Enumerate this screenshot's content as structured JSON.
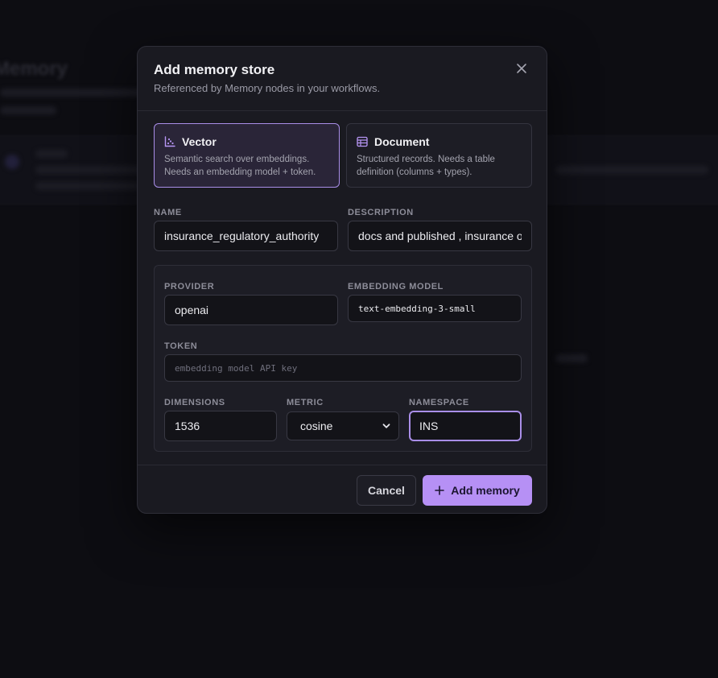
{
  "modal": {
    "title": "Add memory store",
    "subtitle": "Referenced by Memory nodes in your workflows."
  },
  "store_types": [
    {
      "title": "Vector",
      "description": "Semantic search over embeddings. Needs an embedding model + token.",
      "icon": "scatter-chart-icon",
      "selected": true
    },
    {
      "title": "Document",
      "description": "Structured records. Needs a table definition (columns + types).",
      "icon": "table-icon",
      "selected": false
    }
  ],
  "fields": {
    "name": {
      "label": "NAME",
      "value": "insurance_regulatory_authority"
    },
    "description": {
      "label": "DESCRIPTION",
      "value": "docs and published , insurance of"
    },
    "provider": {
      "label": "PROVIDER",
      "value": "openai"
    },
    "embedding_model": {
      "label": "EMBEDDING MODEL",
      "value": "text-embedding-3-small"
    },
    "token": {
      "label": "TOKEN",
      "value": "",
      "placeholder": "embedding model API key"
    },
    "dimensions": {
      "label": "DIMENSIONS",
      "value": "1536"
    },
    "metric": {
      "label": "METRIC",
      "value": "cosine"
    },
    "namespace": {
      "label": "NAMESPACE",
      "value": "INS"
    }
  },
  "footer": {
    "cancel_label": "Cancel",
    "add_label": "Add memory"
  },
  "colors": {
    "accent": "#b690f5",
    "selected_border": "#a98ee8"
  }
}
